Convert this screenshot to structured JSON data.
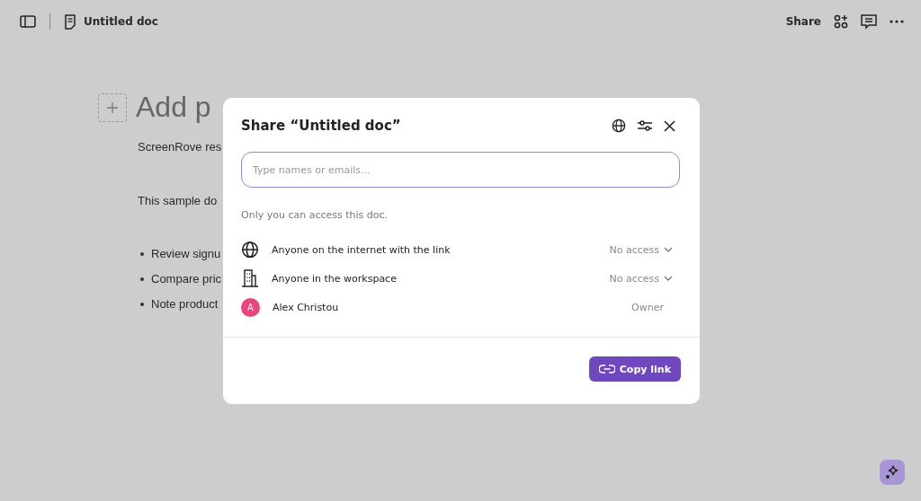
{
  "topbar": {
    "doc_title": "Untitled doc",
    "share": "Share"
  },
  "document": {
    "title": "Add p",
    "paragraphs": [
      "ScreenRove res",
      "This sample do"
    ],
    "bullets": [
      "Review signu",
      "Compare pric",
      "Note product"
    ]
  },
  "dialog": {
    "title": "Share “Untitled doc”",
    "search": {
      "placeholder": "Type names or emails..."
    },
    "notice": "Only you can access this doc.",
    "rows": [
      {
        "kind": "internet",
        "label": "Anyone on the internet with the link",
        "access": "No access",
        "dropdown": true
      },
      {
        "kind": "workspace",
        "label": "Anyone in the workspace",
        "access": "No access",
        "dropdown": true
      },
      {
        "kind": "person",
        "initial": "A",
        "label": "Alex Christou",
        "access": "Owner",
        "dropdown": false
      }
    ],
    "copy_button": "Copy link"
  }
}
